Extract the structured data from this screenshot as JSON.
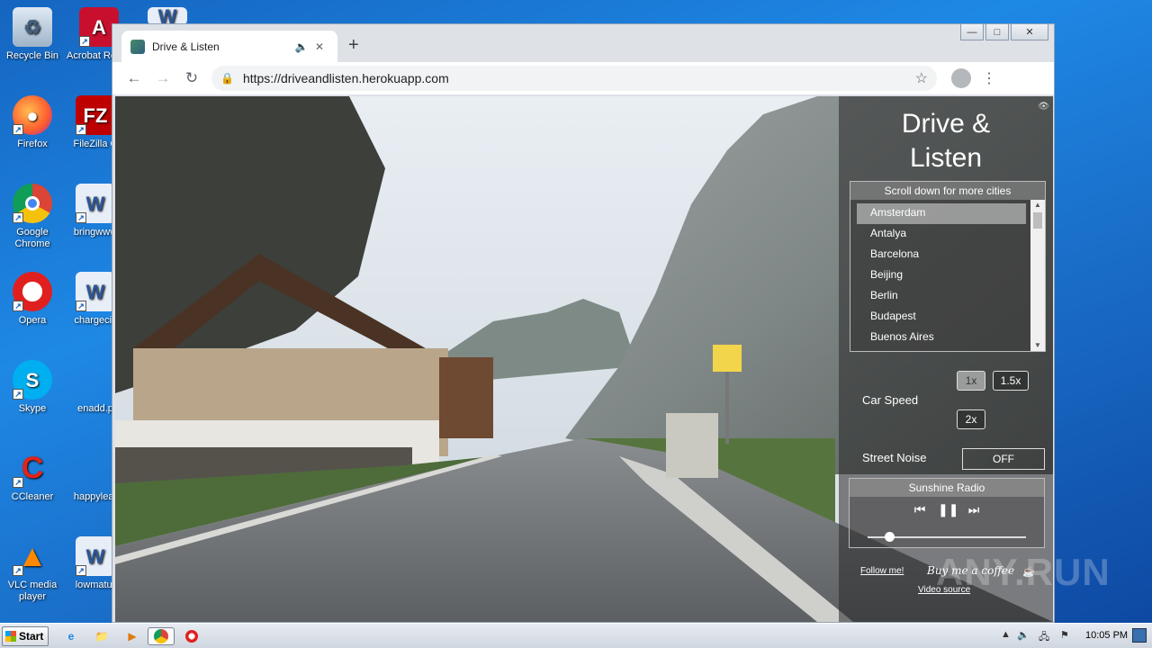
{
  "desktop": {
    "icons": [
      {
        "label": "Recycle Bin"
      },
      {
        "label": "Acrobat Reader"
      },
      {
        "label": "Firefox"
      },
      {
        "label": "FileZilla C"
      },
      {
        "label": "Google Chrome"
      },
      {
        "label": "bringwww"
      },
      {
        "label": "Opera"
      },
      {
        "label": "chargeciv"
      },
      {
        "label": "Skype"
      },
      {
        "label": "enadd.p"
      },
      {
        "label": "CCleaner"
      },
      {
        "label": "happylear"
      },
      {
        "label": "VLC media player"
      },
      {
        "label": "lowmatur"
      }
    ]
  },
  "browser": {
    "tab_title": "Drive & Listen",
    "new_tab_glyph": "+",
    "url": "https://driveandlisten.herokuapp.com"
  },
  "app": {
    "title_line1": "Drive &",
    "title_line2": "Listen",
    "city_hint": "Scroll down for more cities",
    "cities": [
      "Amsterdam",
      "Antalya",
      "Barcelona",
      "Beijing",
      "Berlin",
      "Budapest",
      "Buenos Aires"
    ],
    "selected_city": "Amsterdam",
    "car_speed_label": "Car Speed",
    "speeds": [
      "1x",
      "1.5x",
      "2x"
    ],
    "selected_speed": "1x",
    "street_noise_label": "Street Noise",
    "street_noise_value": "OFF",
    "radio_station": "Sunshine Radio",
    "radio_volume": 0.14,
    "follow_link": "Follow me!",
    "coffee_link": "Buy me a coffee",
    "video_source_link": "Video source"
  },
  "watermark": "ANY.RUN",
  "taskbar": {
    "start_label": "Start",
    "clock": "10:05 PM"
  },
  "colors": {
    "desktop_blue": "#1e88e5",
    "chrome_frame": "#dee1e6",
    "panel_bg": "#282828"
  }
}
